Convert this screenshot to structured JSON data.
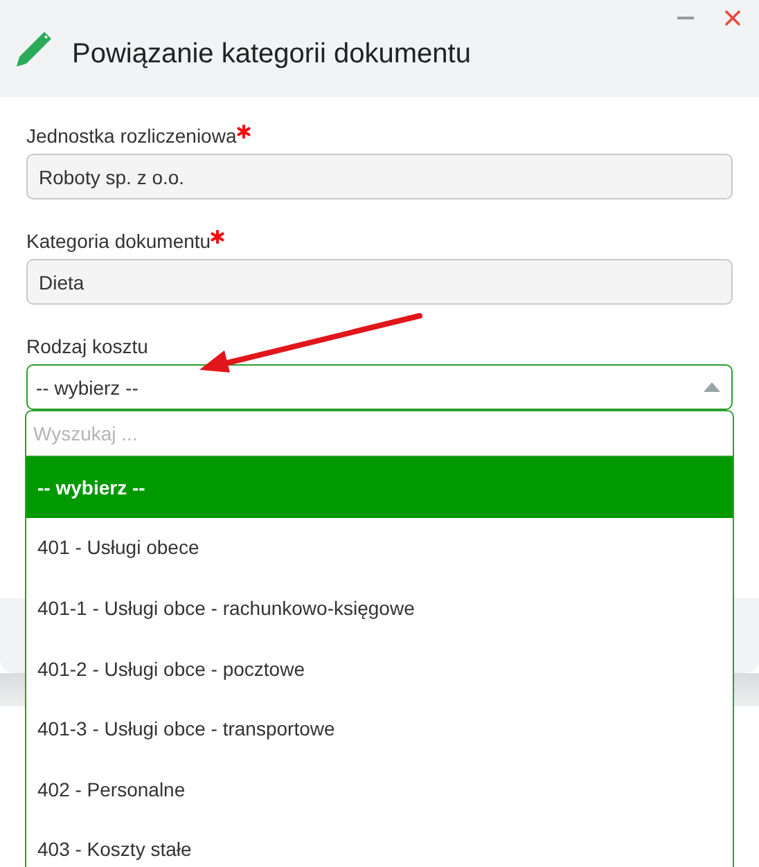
{
  "dialog": {
    "title": "Powiązanie kategorii dokumentu"
  },
  "fields": [
    {
      "label": "Jednostka rozliczeniowa",
      "required": true,
      "value": "Roboty sp. z o.o."
    },
    {
      "label": "Kategoria dokumentu",
      "required": true,
      "value": "Dieta"
    }
  ],
  "select": {
    "label": "Rodzaj kosztu",
    "value": "-- wybierz --",
    "expanded": true
  },
  "dropdown": {
    "placeholder": "Wyszukaj ...",
    "options": [
      {
        "label": "-- wybierz --",
        "selected": true
      },
      {
        "label": "401 - Usługi obece",
        "selected": false
      },
      {
        "label": "401-1 - Usługi obce - rachunkowo-księgowe",
        "selected": false
      },
      {
        "label": "401-2 - Usługi obce - pocztowe",
        "selected": false
      },
      {
        "label": "401-3 - Usługi obce - transportowe",
        "selected": false
      },
      {
        "label": "402 - Personalne",
        "selected": false
      },
      {
        "label": "403 - Koszty stałe",
        "selected": false
      }
    ]
  }
}
